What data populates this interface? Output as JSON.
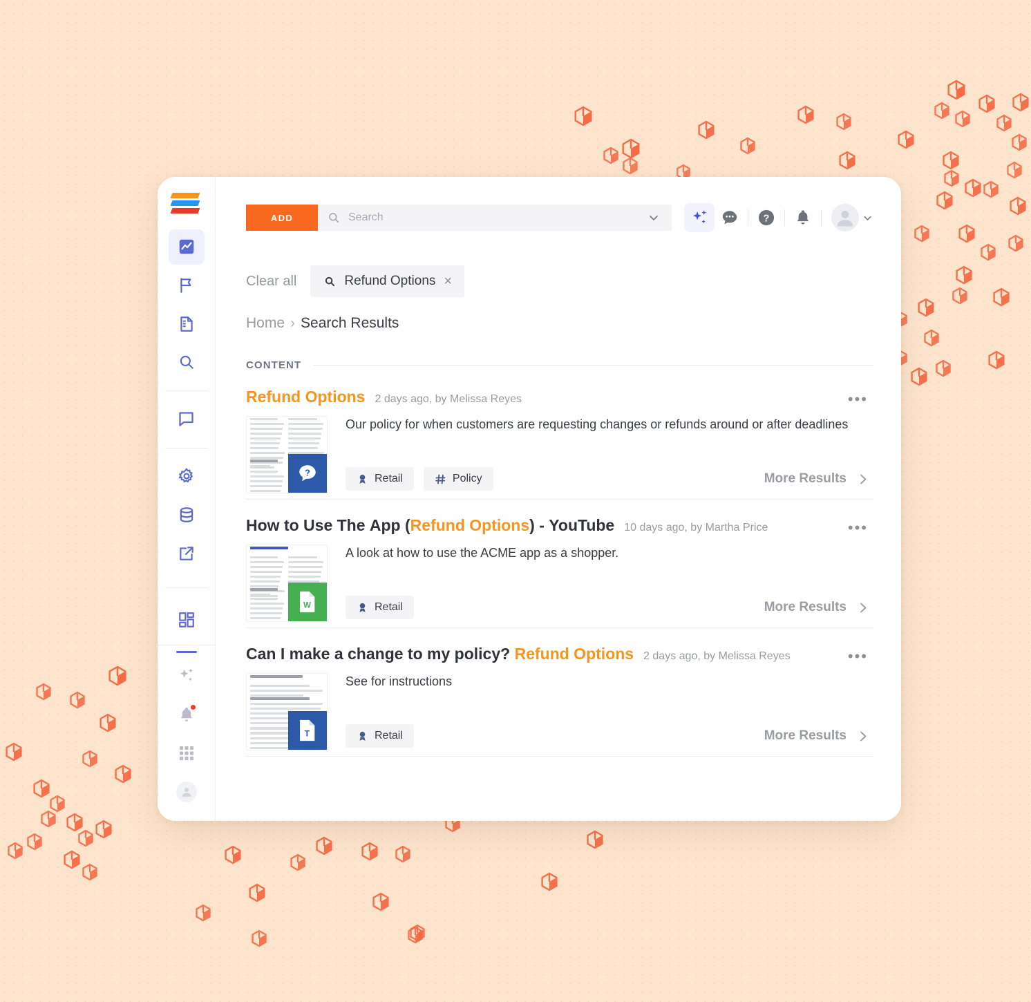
{
  "background": {
    "color": "#fde5cd",
    "accent_hex": "#f4653f"
  },
  "brand": {
    "logo_name": "stacked-bars-logo",
    "logo_colors": [
      "#f7941e",
      "#2196f3",
      "#e8392c"
    ]
  },
  "sidebar": {
    "items": [
      {
        "icon": "chart-line-icon",
        "name": "sidebar-item-analytics",
        "active": true
      },
      {
        "icon": "flag-icon",
        "name": "sidebar-item-flags",
        "active": false
      },
      {
        "icon": "document-icon",
        "name": "sidebar-item-documents",
        "active": false
      },
      {
        "icon": "search-icon",
        "name": "sidebar-item-search",
        "active": false
      },
      {
        "icon": "chat-bubble-icon",
        "name": "sidebar-item-messages",
        "active": false
      },
      {
        "icon": "gear-icon",
        "name": "sidebar-item-settings",
        "active": false
      },
      {
        "icon": "database-icon",
        "name": "sidebar-item-data",
        "active": false
      },
      {
        "icon": "external-link-icon",
        "name": "sidebar-item-open-external",
        "active": false
      },
      {
        "icon": "dashboard-grid-icon",
        "name": "sidebar-item-dashboard",
        "active": false
      }
    ],
    "bottom_items": [
      {
        "icon": "sparkle-ai-icon",
        "name": "sidebar-ai-assistant"
      },
      {
        "icon": "bell-icon",
        "name": "sidebar-notifications",
        "badge": true
      },
      {
        "icon": "apps-grid-icon",
        "name": "sidebar-apps"
      },
      {
        "icon": "user-avatar-icon",
        "name": "sidebar-profile"
      }
    ]
  },
  "toolbar": {
    "add_label": "ADD",
    "search_placeholder": "Search",
    "search_value": "",
    "actions": [
      {
        "name": "ai-assist-button",
        "icon": "sparkle-ai-icon"
      },
      {
        "name": "messages-button",
        "icon": "chat-bubble-icon"
      },
      {
        "name": "help-button",
        "icon": "question-mark-icon"
      },
      {
        "name": "notifications-button",
        "icon": "bell-icon"
      }
    ],
    "avatar_name": "user-avatar"
  },
  "filters": {
    "clear_all_label": "Clear all",
    "chips": [
      {
        "label": "Refund Options",
        "icon": "search-icon",
        "close": "×"
      }
    ]
  },
  "breadcrumb": {
    "home": "Home",
    "separator": "›",
    "current": "Search Results"
  },
  "content": {
    "section_heading": "CONTENT",
    "more_results_label": "More Results",
    "menu_glyph": "•••",
    "results": [
      {
        "title_parts": [
          {
            "text": "Refund Options",
            "highlight": true
          }
        ],
        "meta": "2 days ago, by Melissa Reyes",
        "description": "Our policy for when customers are requesting changes or refunds around or after deadlines",
        "thumbnail": {
          "style": "two-column",
          "badge_icon": "question-bubble-icon",
          "badge_color": "#2c5aa9"
        },
        "tags": [
          {
            "label": "Retail",
            "icon": "ribbon-icon"
          },
          {
            "label": "Policy",
            "icon": "hash-icon"
          }
        ]
      },
      {
        "title_parts": [
          {
            "text": "How to Use The App (",
            "highlight": false
          },
          {
            "text": "Refund Options",
            "highlight": true
          },
          {
            "text": ") - YouTube",
            "highlight": false
          }
        ],
        "meta": "10 days ago, by Martha Price",
        "description": "A look at how to use the ACME app as a shopper.",
        "thumbnail": {
          "style": "two-column-heading",
          "heading": "Transformation",
          "badge_icon": "word-doc-icon",
          "badge_color": "#44b051"
        },
        "tags": [
          {
            "label": "Retail",
            "icon": "ribbon-icon"
          }
        ]
      },
      {
        "title_parts": [
          {
            "text": "Can I make a change to my policy? ",
            "highlight": false
          },
          {
            "text": "Refund Options",
            "highlight": true
          }
        ],
        "meta": "2 days ago, by Melissa Reyes",
        "description": "See for instructions",
        "thumbnail": {
          "style": "single-column",
          "heading": "ormation We Collect",
          "badge_icon": "text-doc-icon",
          "badge_color": "#2c5aa9"
        },
        "tags": [
          {
            "label": "Retail",
            "icon": "ribbon-icon"
          }
        ]
      }
    ]
  }
}
